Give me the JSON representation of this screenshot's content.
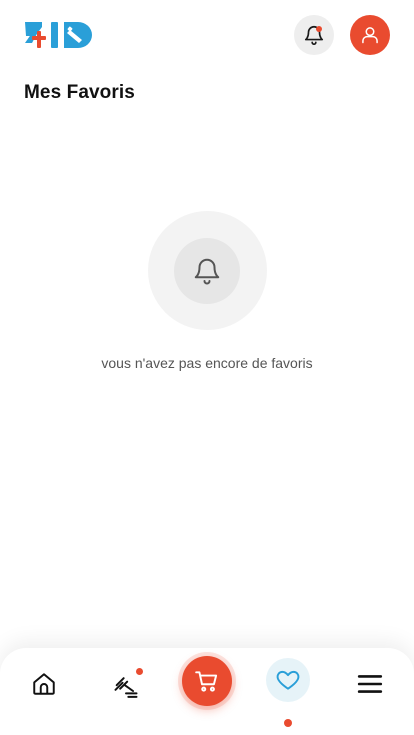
{
  "colors": {
    "accent": "#e94b2f",
    "logo_blue": "#2a9fd8",
    "logo_red": "#e94b2f",
    "notif_bg": "#eeeeee",
    "empty_outer": "#f3f3f3",
    "empty_inner": "#e6e6e6",
    "fav_bg": "#e6f3f8",
    "fav_icon": "#2a9fd8"
  },
  "header": {
    "logo_icon": "zid-logo",
    "notification_icon": "bell-icon",
    "profile_icon": "user-icon"
  },
  "page": {
    "title": "Mes Favoris"
  },
  "empty_state": {
    "icon": "bell-icon",
    "message": "vous n'avez pas encore de favoris"
  },
  "bottom_nav": {
    "items": [
      {
        "icon": "home-icon",
        "active": false
      },
      {
        "icon": "auction-hammer-icon",
        "active": false,
        "has_badge": true
      },
      {
        "icon": "cart-icon",
        "active": false
      },
      {
        "icon": "heart-icon",
        "active": true
      },
      {
        "icon": "menu-icon",
        "active": false
      }
    ]
  }
}
